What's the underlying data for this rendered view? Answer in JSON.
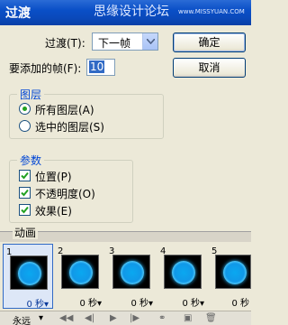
{
  "window": {
    "title": "过渡",
    "watermark": "思缘设计论坛",
    "watermark_url": "www.MISSYUAN.COM"
  },
  "form": {
    "transition_label": "过渡(T):",
    "transition_value": "下一帧",
    "frames_label": "要添加的帧(F):",
    "frames_value": "10"
  },
  "buttons": {
    "ok": "确定",
    "cancel": "取消"
  },
  "layers_group": {
    "title": "图层",
    "options": [
      {
        "label": "所有图层(A)",
        "checked": true
      },
      {
        "label": "选中的图层(S)",
        "checked": false
      }
    ]
  },
  "params_group": {
    "title": "参数",
    "options": [
      {
        "label": "位置(P)",
        "checked": true
      },
      {
        "label": "不透明度(O)",
        "checked": true
      },
      {
        "label": "效果(E)",
        "checked": true
      }
    ]
  },
  "animation": {
    "title": "动画",
    "frames": [
      {
        "number": "1",
        "delay": "0 秒▾"
      },
      {
        "number": "2",
        "delay": "0 秒▾"
      },
      {
        "number": "3",
        "delay": "0 秒▾"
      },
      {
        "number": "4",
        "delay": "0 秒▾"
      },
      {
        "number": "5",
        "delay": "0 秒"
      }
    ],
    "loop": "永远",
    "loop_arrow": "▾"
  },
  "controls": {
    "first": "◀◀",
    "prev": "◀|",
    "play": "▶",
    "next": "|▶",
    "tween": "⚭",
    "new_frame": "▣",
    "delete": "🗑"
  }
}
